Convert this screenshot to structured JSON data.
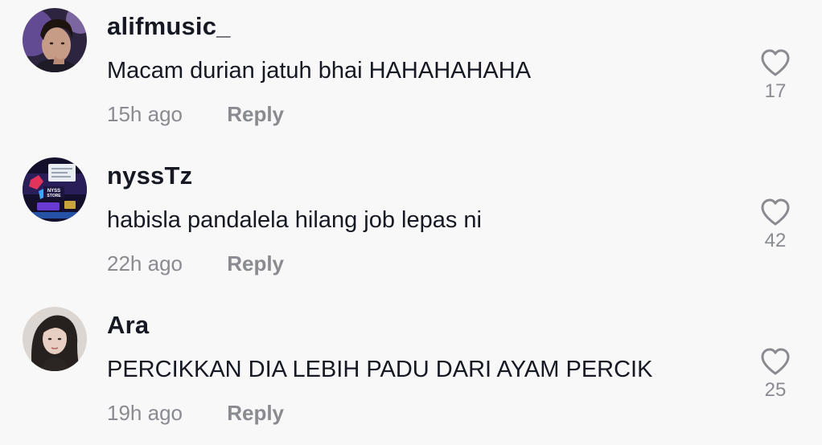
{
  "comments": [
    {
      "username": "alifmusic_",
      "text": "Macam durian jatuh bhai HAHAHAHAHA",
      "time": "15h ago",
      "reply_label": "Reply",
      "likes": "17",
      "avatar_icon": "avatar-photo-purple-light",
      "colors": {
        "bg": "#3b2a55",
        "accent": "#b58cff"
      }
    },
    {
      "username": "nyssTz",
      "text": "habisla pandalela hilang job lepas ni",
      "time": "22h ago",
      "reply_label": "Reply",
      "likes": "42",
      "avatar_icon": "avatar-logo-store",
      "avatar_badge": "NYSS STORE",
      "colors": {
        "bg": "#120c2e",
        "accent": "#e0345a"
      }
    },
    {
      "username": "Ara",
      "text": "PERCIKKAN DIA LEBIH PADU DARI AYAM PERCIK",
      "time": "19h ago",
      "reply_label": "Reply",
      "likes": "25",
      "avatar_icon": "avatar-photo-portrait",
      "colors": {
        "bg": "#d9d4d0",
        "accent": "#2a2522"
      }
    }
  ],
  "icons": {
    "like": "heart-outline-icon"
  },
  "colors": {
    "primary_text": "#161823",
    "secondary_text": "#8a8b91",
    "background": "#f8f8f8"
  }
}
